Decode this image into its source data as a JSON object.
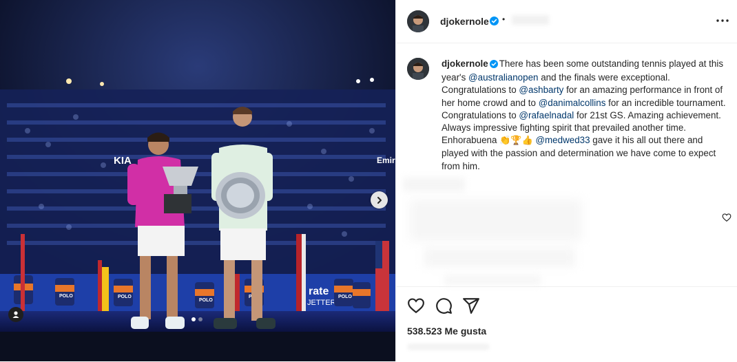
{
  "post": {
    "author": "djokernole",
    "header_separator": "•",
    "images": {
      "count": 2,
      "active_index": 0,
      "banner_texts": [
        "Emir",
        "KIA",
        "rate",
        "JETTER"
      ],
      "ballkid_shirt_text": "POLO"
    },
    "caption": {
      "username": "djokernole",
      "segments": [
        {
          "text": "There has been some outstanding tennis played at this year's ",
          "type": "text"
        },
        {
          "text": "@australianopen",
          "type": "mention"
        },
        {
          "text": " and the finals were exceptional. Congratulations to ",
          "type": "text"
        },
        {
          "text": "@ashbarty",
          "type": "mention"
        },
        {
          "text": " for an amazing performance in front of her home crowd and to ",
          "type": "text"
        },
        {
          "text": "@danimalcollins",
          "type": "mention"
        },
        {
          "text": " for an incredible tournament. Congratulations to ",
          "type": "text"
        },
        {
          "text": "@rafaelnadal",
          "type": "mention"
        },
        {
          "text": " for 21st GS. Amazing achievement. Always impressive fighting spirit that prevailed another time. Enhorabuena ",
          "type": "text"
        },
        {
          "text": "👏🏆👍",
          "type": "emoji"
        },
        {
          "text": " ",
          "type": "text"
        },
        {
          "text": "@medwed33",
          "type": "mention"
        },
        {
          "text": " gave it his all out there and played with the passion and determination we have come to expect from him.",
          "type": "text"
        }
      ]
    },
    "likes_text": "538.523 Me gusta"
  },
  "icons": {
    "verified": "verified-badge-icon",
    "more": "more-options-icon",
    "heart": "heart-icon",
    "comment": "comment-icon",
    "share": "share-icon",
    "comment_like": "heart-icon",
    "carousel_next": "chevron-right-icon",
    "tagged": "user-tag-icon"
  },
  "colors": {
    "verified": "#0095f6",
    "mention": "#00376b",
    "text": "#262626"
  }
}
